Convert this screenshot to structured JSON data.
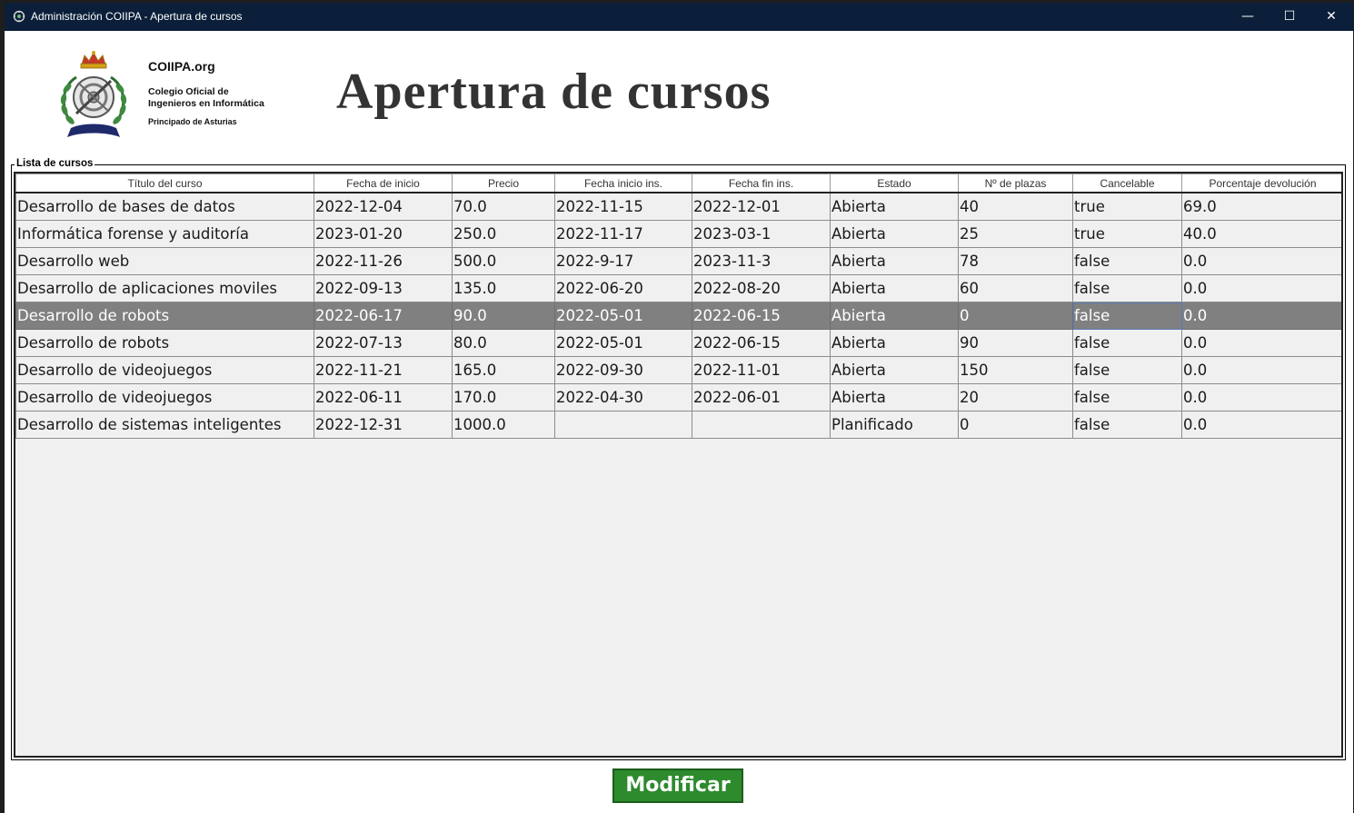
{
  "window": {
    "title": "Administración COIIPA - Apertura de cursos",
    "minimize_symbol": "—",
    "maximize_symbol": "☐",
    "close_symbol": "✕"
  },
  "header": {
    "org_name": "COIIPA.org",
    "org_line1": "Colegio Oficial de",
    "org_line2": "Ingenieros en Informática",
    "org_line3": "Principado de Asturias",
    "page_title": "Apertura de cursos"
  },
  "course_list": {
    "legend": "Lista de cursos",
    "columns": [
      "Título del curso",
      "Fecha de inicio",
      "Precio",
      "Fecha inicio ins.",
      "Fecha fin ins.",
      "Estado",
      "Nº de plazas",
      "Cancelable",
      "Porcentaje devolución"
    ],
    "selected_row_index": 4,
    "rows": [
      [
        "Desarrollo de bases de datos",
        "2022-12-04",
        "70.0",
        "2022-11-15",
        "2022-12-01",
        "Abierta",
        "40",
        "true",
        "69.0"
      ],
      [
        "Informática forense y auditoría",
        "2023-01-20",
        "250.0",
        "2022-11-17",
        "2023-03-1",
        "Abierta",
        "25",
        "true",
        "40.0"
      ],
      [
        "Desarrollo web",
        "2022-11-26",
        "500.0",
        "2022-9-17",
        "2023-11-3",
        "Abierta",
        "78",
        "false",
        "0.0"
      ],
      [
        "Desarrollo de aplicaciones moviles",
        "2022-09-13",
        "135.0",
        "2022-06-20",
        "2022-08-20",
        "Abierta",
        "60",
        "false",
        "0.0"
      ],
      [
        "Desarrollo de robots",
        "2022-06-17",
        "90.0",
        "2022-05-01",
        "2022-06-15",
        "Abierta",
        "0",
        "false",
        "0.0"
      ],
      [
        "Desarrollo de robots",
        "2022-07-13",
        "80.0",
        "2022-05-01",
        "2022-06-15",
        "Abierta",
        "90",
        "false",
        "0.0"
      ],
      [
        "Desarrollo de videojuegos",
        "2022-11-21",
        "165.0",
        "2022-09-30",
        "2022-11-01",
        "Abierta",
        "150",
        "false",
        "0.0"
      ],
      [
        "Desarrollo de videojuegos",
        "2022-06-11",
        "170.0",
        "2022-04-30",
        "2022-06-01",
        "Abierta",
        "20",
        "false",
        "0.0"
      ],
      [
        "Desarrollo de sistemas inteligentes",
        "2022-12-31",
        "1000.0",
        "",
        "",
        "Planificado",
        "0",
        "false",
        "0.0"
      ]
    ]
  },
  "actions": {
    "modify_label": "Modificar"
  },
  "colors": {
    "titlebar": "#0b1f3a",
    "selected_row": "#808080",
    "modify_button": "#2d8a2d",
    "table_background": "#f0f0f0"
  }
}
